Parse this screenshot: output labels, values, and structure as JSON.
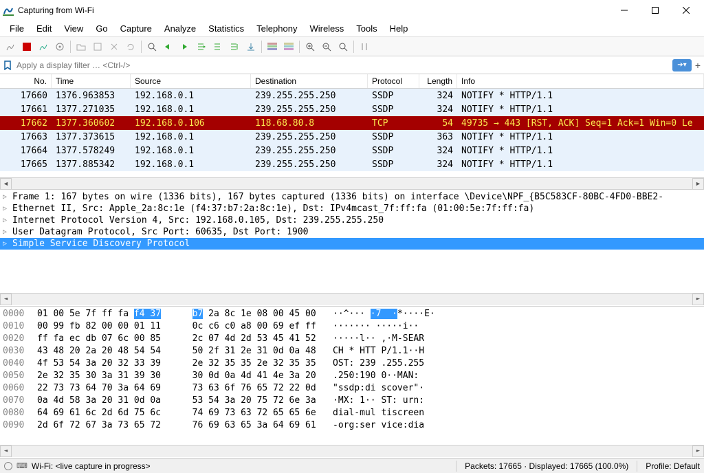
{
  "window": {
    "title": "Capturing from Wi-Fi"
  },
  "menu": [
    "File",
    "Edit",
    "View",
    "Go",
    "Capture",
    "Analyze",
    "Statistics",
    "Telephony",
    "Wireless",
    "Tools",
    "Help"
  ],
  "filter": {
    "placeholder": "Apply a display filter … <Ctrl-/>"
  },
  "columns": {
    "no": "No.",
    "time": "Time",
    "source": "Source",
    "dest": "Destination",
    "proto": "Protocol",
    "len": "Length",
    "info": "Info"
  },
  "packets": [
    {
      "no": "17660",
      "time": "1376.963853",
      "src": "192.168.0.1",
      "dst": "239.255.255.250",
      "proto": "SSDP",
      "len": "324",
      "info": "NOTIFY * HTTP/1.1",
      "style": "light"
    },
    {
      "no": "17661",
      "time": "1377.271035",
      "src": "192.168.0.1",
      "dst": "239.255.255.250",
      "proto": "SSDP",
      "len": "324",
      "info": "NOTIFY * HTTP/1.1",
      "style": "light"
    },
    {
      "no": "17662",
      "time": "1377.360602",
      "src": "192.168.0.106",
      "dst": "118.68.80.8",
      "proto": "TCP",
      "len": "54",
      "info": "49735 → 443 [RST, ACK] Seq=1 Ack=1 Win=0 Le",
      "style": "red"
    },
    {
      "no": "17663",
      "time": "1377.373615",
      "src": "192.168.0.1",
      "dst": "239.255.255.250",
      "proto": "SSDP",
      "len": "363",
      "info": "NOTIFY * HTTP/1.1",
      "style": "light"
    },
    {
      "no": "17664",
      "time": "1377.578249",
      "src": "192.168.0.1",
      "dst": "239.255.255.250",
      "proto": "SSDP",
      "len": "324",
      "info": "NOTIFY * HTTP/1.1",
      "style": "light"
    },
    {
      "no": "17665",
      "time": "1377.885342",
      "src": "192.168.0.1",
      "dst": "239.255.255.250",
      "proto": "SSDP",
      "len": "324",
      "info": "NOTIFY * HTTP/1.1",
      "style": "light"
    }
  ],
  "tree": [
    "Frame 1: 167 bytes on wire (1336 bits), 167 bytes captured (1336 bits) on interface \\Device\\NPF_{B5C583CF-80BC-4FD0-BBE2-",
    "Ethernet II, Src: Apple_2a:8c:1e (f4:37:b7:2a:8c:1e), Dst: IPv4mcast_7f:ff:fa (01:00:5e:7f:ff:fa)",
    "Internet Protocol Version 4, Src: 192.168.0.105, Dst: 239.255.255.250",
    "User Datagram Protocol, Src Port: 60635, Dst Port: 1900",
    "Simple Service Discovery Protocol"
  ],
  "hex": [
    {
      "off": "0000",
      "b1": "01 00 5e 7f ff fa ",
      "hl1": "f4 37",
      "mid": "  ",
      "hl2": "b7",
      "b2": " 2a 8c 1e 08 00 45 00",
      "asc": "··^··· ",
      "aHl": "·7  ·",
      "asc2": "*····E·"
    },
    {
      "off": "0010",
      "b1": "00 99 fb 82 00 00 01 11",
      "b2": "  0c c6 c0 a8 00 69 ef ff",
      "asc": "······· ·····i··"
    },
    {
      "off": "0020",
      "b1": "ff fa ec db 07 6c 00 85",
      "b2": "  2c 07 4d 2d 53 45 41 52",
      "asc": "·····l·· ,·M-SEAR"
    },
    {
      "off": "0030",
      "b1": "43 48 20 2a 20 48 54 54",
      "b2": "  50 2f 31 2e 31 0d 0a 48",
      "asc": "CH * HTT P/1.1··H"
    },
    {
      "off": "0040",
      "b1": "4f 53 54 3a 20 32 33 39",
      "b2": "  2e 32 35 35 2e 32 35 35",
      "asc": "OST: 239 .255.255"
    },
    {
      "off": "0050",
      "b1": "2e 32 35 30 3a 31 39 30",
      "b2": "  30 0d 0a 4d 41 4e 3a 20",
      "asc": ".250:190 0··MAN: "
    },
    {
      "off": "0060",
      "b1": "22 73 73 64 70 3a 64 69",
      "b2": "  73 63 6f 76 65 72 22 0d",
      "asc": "\"ssdp:di scover\"·"
    },
    {
      "off": "0070",
      "b1": "0a 4d 58 3a 20 31 0d 0a",
      "b2": "  53 54 3a 20 75 72 6e 3a",
      "asc": "·MX: 1·· ST: urn:"
    },
    {
      "off": "0080",
      "b1": "64 69 61 6c 2d 6d 75 6c",
      "b2": "  74 69 73 63 72 65 65 6e",
      "asc": "dial-mul tiscreen"
    },
    {
      "off": "0090",
      "b1": "2d 6f 72 67 3a 73 65 72",
      "b2": "  76 69 63 65 3a 64 69 61",
      "asc": "-org:ser vice:dia"
    }
  ],
  "status": {
    "capture": "Wi-Fi: <live capture in progress>",
    "packets": "Packets: 17665 · Displayed: 17665 (100.0%)",
    "profile": "Profile: Default"
  }
}
